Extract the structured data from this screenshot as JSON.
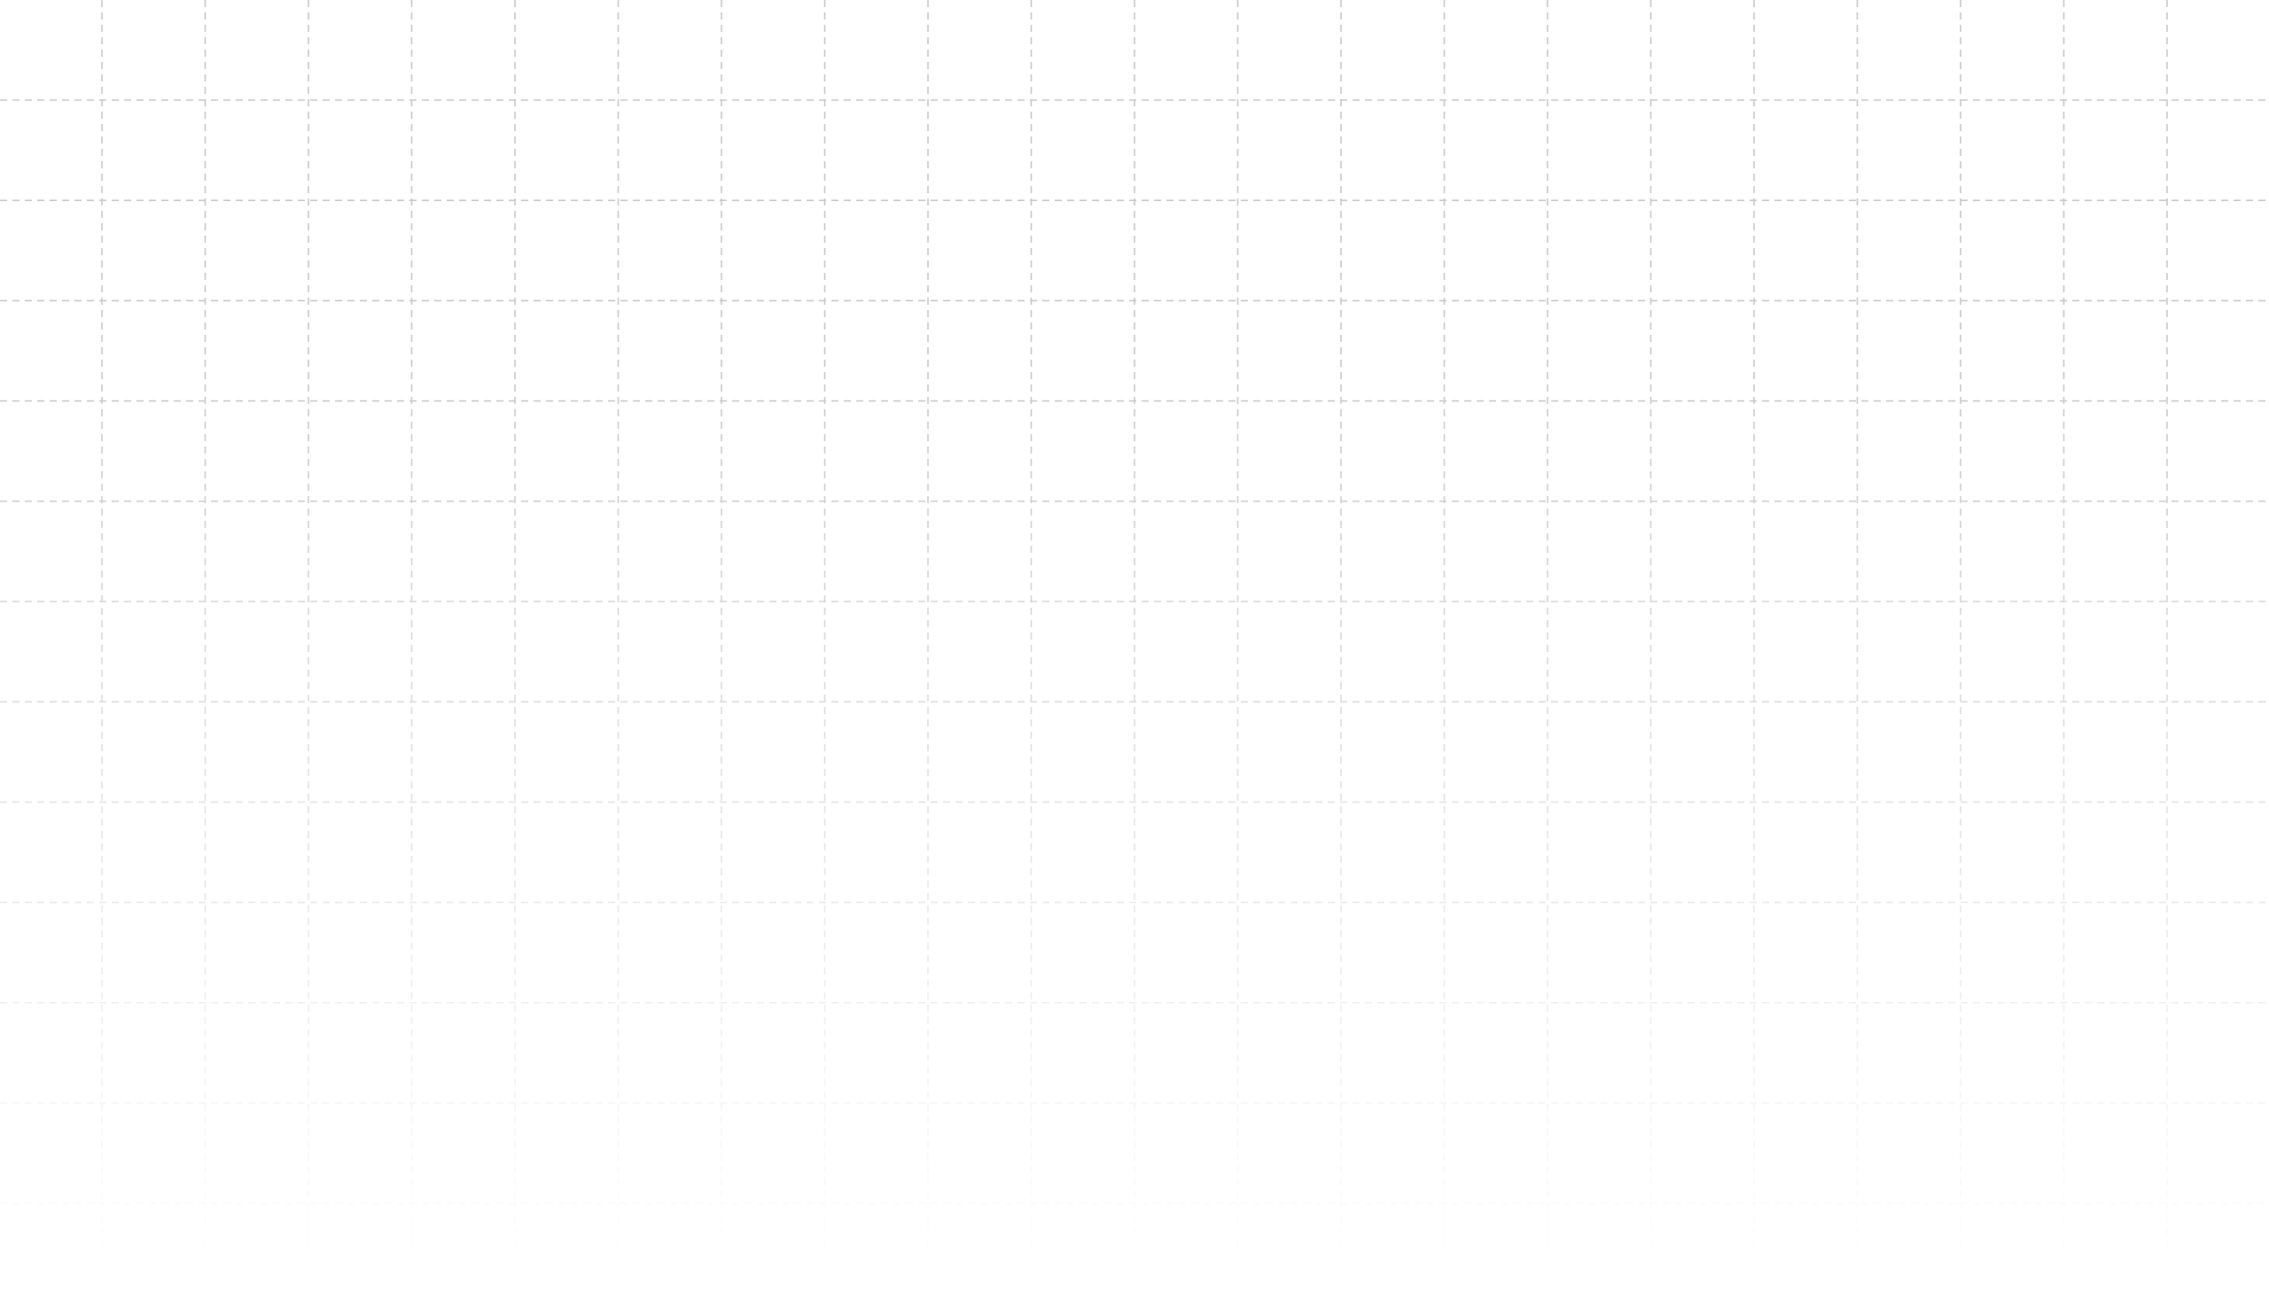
{
  "canvas": {
    "background_color": "#ffffff",
    "grid": {
      "visible": true,
      "line_style": "dashed",
      "line_color": "#c9c9c9",
      "fades_toward_bottom": true
    }
  }
}
